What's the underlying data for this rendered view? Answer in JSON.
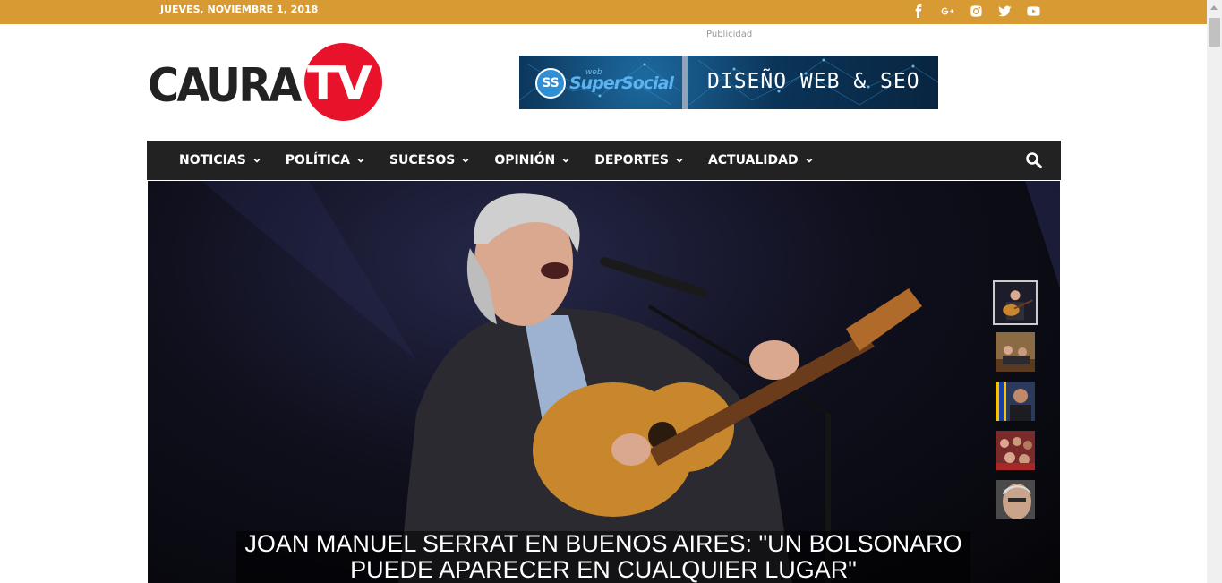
{
  "topbar": {
    "date": "JUEVES, NOVIEMBRE 1, 2018",
    "social": [
      "facebook-icon",
      "google-plus-icon",
      "instagram-icon",
      "twitter-icon",
      "youtube-icon"
    ],
    "color": "#d89b33"
  },
  "header": {
    "logo_text_1": "CAURA",
    "logo_text_2": "TV",
    "ad_label": "Publicidad",
    "banner": {
      "small": "web",
      "brand": "SuperSocial",
      "tagline": "DISEÑO WEB & SEO"
    }
  },
  "nav": {
    "items": [
      {
        "label": "NOTICIAS"
      },
      {
        "label": "POLÍTICA"
      },
      {
        "label": "SUCESOS"
      },
      {
        "label": "OPINIÓN"
      },
      {
        "label": "DEPORTES"
      },
      {
        "label": "ACTUALIDAD"
      }
    ],
    "search_icon": "search-icon"
  },
  "hero": {
    "headline": "JOAN MANUEL SERRAT EN BUENOS AIRES: \"UN BOLSONARO PUEDE APARECER EN CUALQUIER LUGAR\"",
    "thumbnails": [
      "slide-1",
      "slide-2",
      "slide-3",
      "slide-4",
      "slide-5"
    ]
  },
  "colors": {
    "accent": "#d89b33",
    "logo_red": "#e8132b",
    "nav_bg": "#222222"
  }
}
